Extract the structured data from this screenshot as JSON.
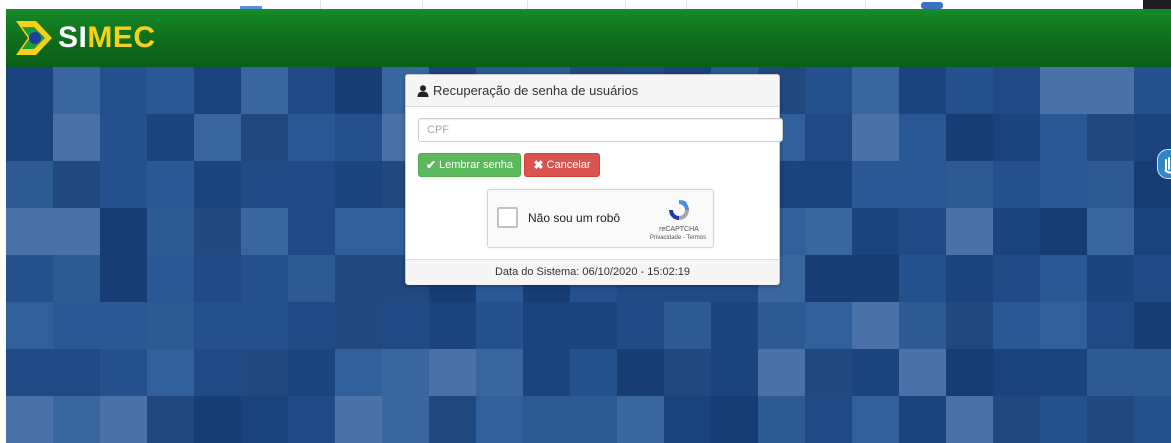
{
  "header": {
    "brand": "SIMEC",
    "brand_first": "SI",
    "brand_rest": "MEC"
  },
  "colors": {
    "header_green": "#0c6b1b",
    "brand_yellow": "#f7d117",
    "success": "#5cb85c",
    "danger": "#d9534f",
    "background_blue": "#24508e"
  },
  "modal": {
    "title": "Recuperação de senha de usuários",
    "title_icon": "user-icon",
    "cpf_placeholder": "CPF",
    "cpf_value": "",
    "remind_button": "Lembrar senha",
    "remind_icon": "check-icon",
    "cancel_button": "Cancelar",
    "cancel_icon": "times-icon",
    "footer": "Data do Sistema: 06/10/2020 - 15:02:19"
  },
  "recaptcha": {
    "label": "Não sou um robô",
    "brand": "reCAPTCHA",
    "links": "Privacidade - Termos"
  },
  "side_widget": {
    "icon": "accessibility-hand-icon"
  }
}
